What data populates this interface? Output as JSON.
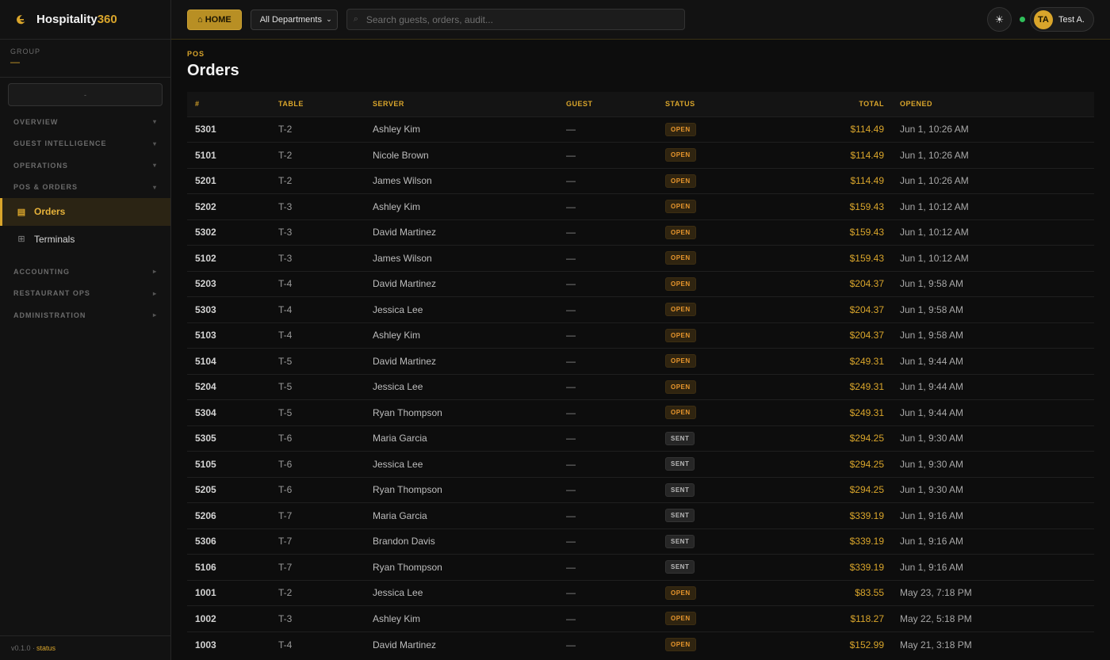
{
  "brand": {
    "name": "Hospitality",
    "accent": "360",
    "logo_icon": "crescent-logo-icon"
  },
  "group": {
    "label": "GROUP",
    "value": "—",
    "select_value": "-"
  },
  "nav": {
    "sections": [
      {
        "label": "OVERVIEW",
        "chevron": "▾"
      },
      {
        "label": "GUEST INTELLIGENCE",
        "chevron": "▾"
      },
      {
        "label": "OPERATIONS",
        "chevron": "▾"
      },
      {
        "label": "POS & ORDERS",
        "chevron": "▾"
      },
      {
        "label": "ACCOUNTING",
        "chevron": "▸"
      },
      {
        "label": "RESTAURANT OPS",
        "chevron": "▸"
      },
      {
        "label": "ADMINISTRATION",
        "chevron": "▸"
      }
    ],
    "items": [
      {
        "label": "Orders",
        "icon": "receipt-icon",
        "glyph": "▤"
      },
      {
        "label": "Terminals",
        "icon": "grid-icon",
        "glyph": "⊞"
      }
    ]
  },
  "footer": {
    "version": "v0.1.0 · ",
    "status": "status"
  },
  "topbar": {
    "home_label": "⌂ HOME",
    "department": "All Departments",
    "search_placeholder": "Search guests, orders, audit...",
    "theme_icon": "☀",
    "user_initials": "TA",
    "user_name": "Test A."
  },
  "page": {
    "breadcrumb": "POS",
    "title": "Orders"
  },
  "table": {
    "columns": [
      "#",
      "TABLE",
      "SERVER",
      "GUEST",
      "STATUS",
      "TOTAL",
      "OPENED"
    ],
    "rows": [
      {
        "id": "5301",
        "table": "T-2",
        "server": "Ashley Kim",
        "guest": "—",
        "status": "OPEN",
        "total": "$114.49",
        "opened": "Jun 1, 10:26 AM"
      },
      {
        "id": "5101",
        "table": "T-2",
        "server": "Nicole Brown",
        "guest": "—",
        "status": "OPEN",
        "total": "$114.49",
        "opened": "Jun 1, 10:26 AM"
      },
      {
        "id": "5201",
        "table": "T-2",
        "server": "James Wilson",
        "guest": "—",
        "status": "OPEN",
        "total": "$114.49",
        "opened": "Jun 1, 10:26 AM"
      },
      {
        "id": "5202",
        "table": "T-3",
        "server": "Ashley Kim",
        "guest": "—",
        "status": "OPEN",
        "total": "$159.43",
        "opened": "Jun 1, 10:12 AM"
      },
      {
        "id": "5302",
        "table": "T-3",
        "server": "David Martinez",
        "guest": "—",
        "status": "OPEN",
        "total": "$159.43",
        "opened": "Jun 1, 10:12 AM"
      },
      {
        "id": "5102",
        "table": "T-3",
        "server": "James Wilson",
        "guest": "—",
        "status": "OPEN",
        "total": "$159.43",
        "opened": "Jun 1, 10:12 AM"
      },
      {
        "id": "5203",
        "table": "T-4",
        "server": "David Martinez",
        "guest": "—",
        "status": "OPEN",
        "total": "$204.37",
        "opened": "Jun 1, 9:58 AM"
      },
      {
        "id": "5303",
        "table": "T-4",
        "server": "Jessica Lee",
        "guest": "—",
        "status": "OPEN",
        "total": "$204.37",
        "opened": "Jun 1, 9:58 AM"
      },
      {
        "id": "5103",
        "table": "T-4",
        "server": "Ashley Kim",
        "guest": "—",
        "status": "OPEN",
        "total": "$204.37",
        "opened": "Jun 1, 9:58 AM"
      },
      {
        "id": "5104",
        "table": "T-5",
        "server": "David Martinez",
        "guest": "—",
        "status": "OPEN",
        "total": "$249.31",
        "opened": "Jun 1, 9:44 AM"
      },
      {
        "id": "5204",
        "table": "T-5",
        "server": "Jessica Lee",
        "guest": "—",
        "status": "OPEN",
        "total": "$249.31",
        "opened": "Jun 1, 9:44 AM"
      },
      {
        "id": "5304",
        "table": "T-5",
        "server": "Ryan Thompson",
        "guest": "—",
        "status": "OPEN",
        "total": "$249.31",
        "opened": "Jun 1, 9:44 AM"
      },
      {
        "id": "5305",
        "table": "T-6",
        "server": "Maria Garcia",
        "guest": "—",
        "status": "SENT",
        "total": "$294.25",
        "opened": "Jun 1, 9:30 AM"
      },
      {
        "id": "5105",
        "table": "T-6",
        "server": "Jessica Lee",
        "guest": "—",
        "status": "SENT",
        "total": "$294.25",
        "opened": "Jun 1, 9:30 AM"
      },
      {
        "id": "5205",
        "table": "T-6",
        "server": "Ryan Thompson",
        "guest": "—",
        "status": "SENT",
        "total": "$294.25",
        "opened": "Jun 1, 9:30 AM"
      },
      {
        "id": "5206",
        "table": "T-7",
        "server": "Maria Garcia",
        "guest": "—",
        "status": "SENT",
        "total": "$339.19",
        "opened": "Jun 1, 9:16 AM"
      },
      {
        "id": "5306",
        "table": "T-7",
        "server": "Brandon Davis",
        "guest": "—",
        "status": "SENT",
        "total": "$339.19",
        "opened": "Jun 1, 9:16 AM"
      },
      {
        "id": "5106",
        "table": "T-7",
        "server": "Ryan Thompson",
        "guest": "—",
        "status": "SENT",
        "total": "$339.19",
        "opened": "Jun 1, 9:16 AM"
      },
      {
        "id": "1001",
        "table": "T-2",
        "server": "Jessica Lee",
        "guest": "—",
        "status": "OPEN",
        "total": "$83.55",
        "opened": "May 23, 7:18 PM"
      },
      {
        "id": "1002",
        "table": "T-3",
        "server": "Ashley Kim",
        "guest": "—",
        "status": "OPEN",
        "total": "$118.27",
        "opened": "May 22, 5:18 PM"
      },
      {
        "id": "1003",
        "table": "T-4",
        "server": "David Martinez",
        "guest": "—",
        "status": "OPEN",
        "total": "$152.99",
        "opened": "May 21, 3:18 PM"
      }
    ]
  },
  "colors": {
    "accent": "#d9a52b",
    "open": "#e8962c",
    "online": "#2fbf5a"
  }
}
